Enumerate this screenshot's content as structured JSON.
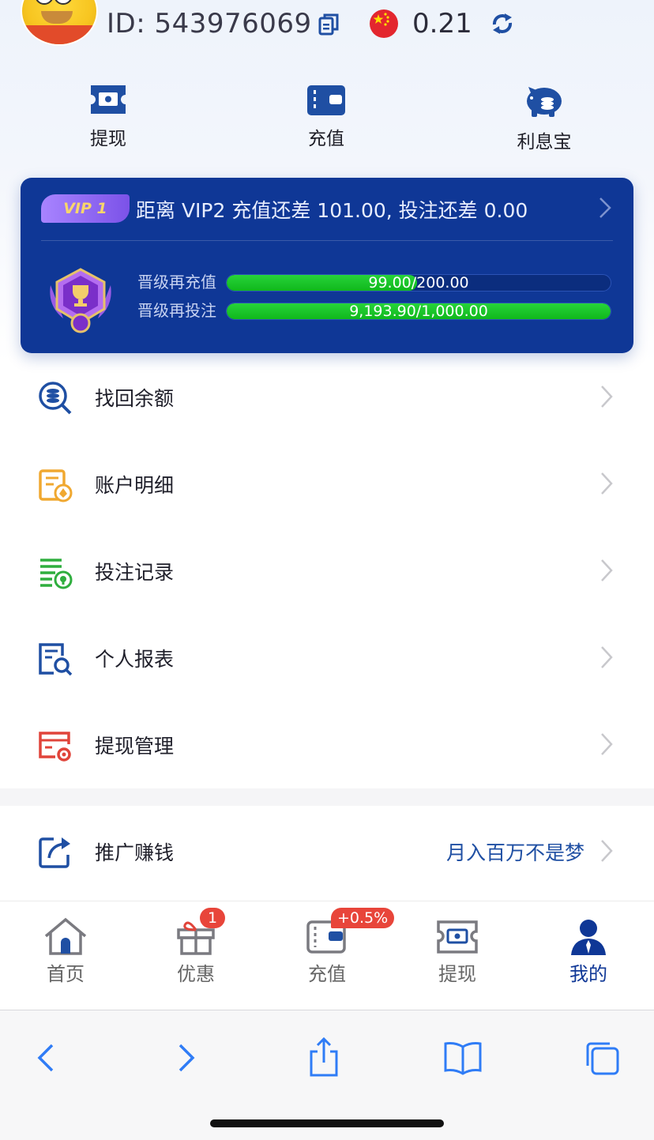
{
  "header": {
    "id_text": "ID: 543976069",
    "balance": "0.21",
    "flag_icon": "china-flag-icon",
    "copy_icon": "copy-icon",
    "refresh_icon": "refresh-icon"
  },
  "quick_actions": [
    {
      "label": "提现",
      "icon": "withdraw-ticket-icon"
    },
    {
      "label": "充值",
      "icon": "wallet-icon"
    },
    {
      "label": "利息宝",
      "icon": "piggy-bank-icon"
    }
  ],
  "vip": {
    "badge": "VIP 1",
    "message": "距离  VIP2  充值还差  101.00,  投注还差 0.00",
    "recharge_label": "晋级再充值",
    "recharge_text": "99.00/200.00",
    "recharge_progress": 0.495,
    "bet_label": "晋级再投注",
    "bet_text": "9,193.90/1,000.00",
    "bet_progress": 1.0
  },
  "menu": [
    {
      "label": "找回余额",
      "icon": "search-coin-icon",
      "color": "#1f4fa3"
    },
    {
      "label": "账户明细",
      "icon": "account-detail-icon",
      "color": "#f0a830"
    },
    {
      "label": "投注记录",
      "icon": "bet-record-icon",
      "color": "#2fae3e"
    },
    {
      "label": "个人报表",
      "icon": "report-search-icon",
      "color": "#1f4fa3"
    },
    {
      "label": "提现管理",
      "icon": "withdraw-manage-icon",
      "color": "#e0443a"
    }
  ],
  "promo": {
    "label": "推广赚钱",
    "slogan": "月入百万不是梦",
    "icon": "share-icon"
  },
  "tabbar": [
    {
      "label": "首页",
      "icon": "home-icon"
    },
    {
      "label": "优惠",
      "icon": "gift-icon",
      "badge": "1"
    },
    {
      "label": "充值",
      "icon": "wallet-icon",
      "badge": "+0.5%"
    },
    {
      "label": "提现",
      "icon": "withdraw-ticket-icon"
    },
    {
      "label": "我的",
      "icon": "user-icon",
      "active": true
    }
  ],
  "colors": {
    "primary": "#0f3796",
    "progress_green": "#10b81c",
    "badge_red": "#e8453a"
  }
}
